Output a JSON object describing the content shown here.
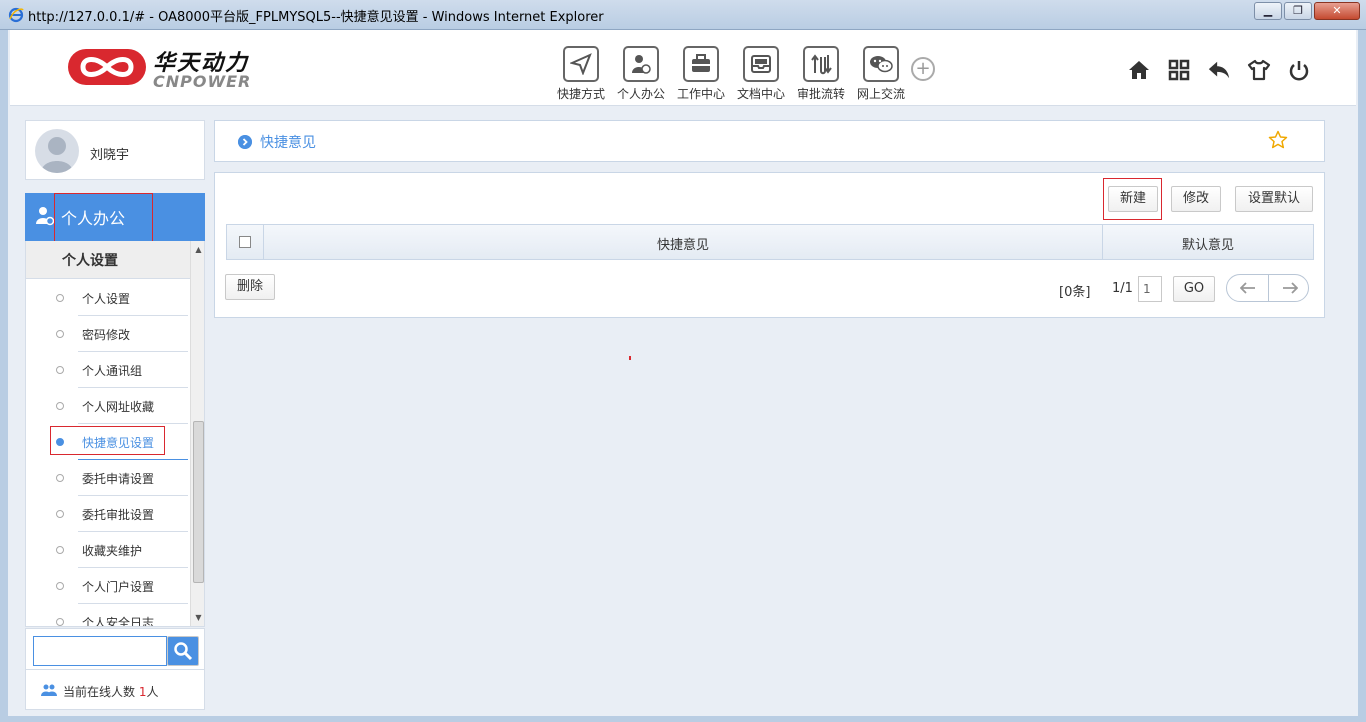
{
  "window": {
    "title": "http://127.0.0.1/# - OA8000平台版_FPLMYSQL5--快捷意见设置 - Windows Internet Explorer"
  },
  "brand": {
    "name_cn": "华天动力",
    "name_en": "CNPOWER",
    "accent": "#d9282f"
  },
  "topnav": [
    {
      "label": "快捷方式",
      "icon": "paper-plane-icon"
    },
    {
      "label": "个人办公",
      "icon": "person-badge-icon"
    },
    {
      "label": "工作中心",
      "icon": "briefcase-icon"
    },
    {
      "label": "文档中心",
      "icon": "inbox-tray-icon"
    },
    {
      "label": "审批流转",
      "icon": "flow-arrows-icon"
    },
    {
      "label": "网上交流",
      "icon": "chat-bubbles-icon"
    }
  ],
  "toolbar_icons": [
    "home-icon",
    "grid-apps-icon",
    "back-reply-icon",
    "shirt-theme-icon",
    "power-icon"
  ],
  "user": {
    "name": "刘晓宇"
  },
  "sidebar": {
    "module_label": "个人办公",
    "group_label": "个人设置",
    "items": [
      {
        "label": "个人设置",
        "active": false
      },
      {
        "label": "密码修改",
        "active": false
      },
      {
        "label": "个人通讯组",
        "active": false
      },
      {
        "label": "个人网址收藏",
        "active": false
      },
      {
        "label": "快捷意见设置",
        "active": true
      },
      {
        "label": "委托申请设置",
        "active": false
      },
      {
        "label": "委托审批设置",
        "active": false
      },
      {
        "label": "收藏夹维护",
        "active": false
      },
      {
        "label": "个人门户设置",
        "active": false
      },
      {
        "label": "个人安全日志",
        "active": false
      }
    ],
    "online_prefix": "当前在线人数",
    "online_count": "1",
    "online_suffix": "人"
  },
  "main": {
    "breadcrumb": "快捷意见",
    "buttons": {
      "new": "新建",
      "edit": "修改",
      "set_default": "设置默认",
      "delete": "删除"
    },
    "table": {
      "columns": [
        "快捷意见",
        "默认意见"
      ],
      "rows": []
    },
    "pager": {
      "total": "[0条]",
      "page": "1/1",
      "input_value": "1",
      "go": "GO"
    }
  },
  "colors": {
    "accent_blue": "#4a90e2",
    "highlight_red": "#d9282f"
  }
}
